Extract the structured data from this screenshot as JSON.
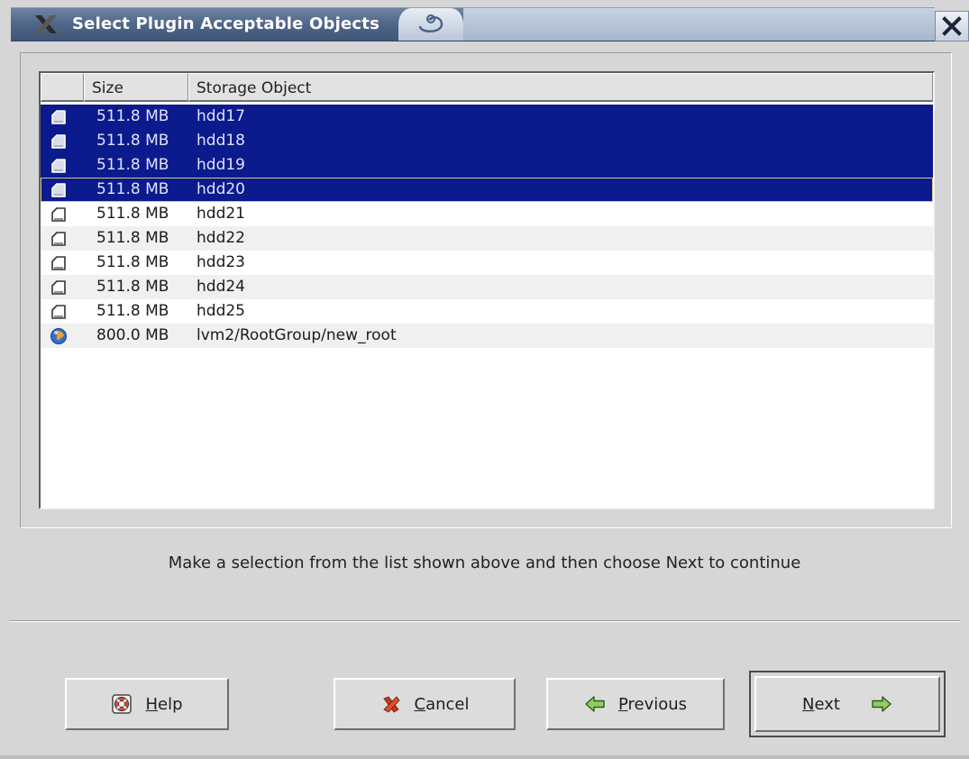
{
  "window": {
    "title": "Select Plugin Acceptable Objects",
    "close_icon": "close-x-icon"
  },
  "table": {
    "columns": [
      "",
      "Size",
      "Storage Object"
    ],
    "rows": [
      {
        "icon": "disk-icon",
        "size": "511.8 MB",
        "name": "hdd17",
        "selected": true
      },
      {
        "icon": "disk-icon",
        "size": "511.8 MB",
        "name": "hdd18",
        "selected": true
      },
      {
        "icon": "disk-icon",
        "size": "511.8 MB",
        "name": "hdd19",
        "selected": true
      },
      {
        "icon": "disk-icon",
        "size": "511.8 MB",
        "name": "hdd20",
        "selected": true,
        "focused": true
      },
      {
        "icon": "disk-icon",
        "size": "511.8 MB",
        "name": "hdd21",
        "selected": false
      },
      {
        "icon": "disk-icon",
        "size": "511.8 MB",
        "name": "hdd22",
        "selected": false
      },
      {
        "icon": "disk-icon",
        "size": "511.8 MB",
        "name": "hdd23",
        "selected": false
      },
      {
        "icon": "disk-icon",
        "size": "511.8 MB",
        "name": "hdd24",
        "selected": false
      },
      {
        "icon": "disk-icon",
        "size": "511.8 MB",
        "name": "hdd25",
        "selected": false
      },
      {
        "icon": "globe-icon",
        "size": "800.0 MB",
        "name": "lvm2/RootGroup/new_root",
        "selected": false
      }
    ]
  },
  "message": "Make a selection from the list shown above and then choose Next to continue",
  "buttons": {
    "help": {
      "mnemonic": "H",
      "rest": "elp",
      "icon": "lifebuoy-icon"
    },
    "cancel": {
      "mnemonic": "C",
      "rest": "ancel",
      "icon": "cancel-x-icon"
    },
    "previous": {
      "mnemonic": "P",
      "rest": "revious",
      "icon": "arrow-left-icon"
    },
    "next": {
      "mnemonic": "N",
      "rest": "ext",
      "icon": "arrow-right-icon"
    }
  },
  "colors": {
    "selection": "#0b1a8c",
    "title_bar": "#4f6688",
    "arrow_green": "#58a23a"
  }
}
